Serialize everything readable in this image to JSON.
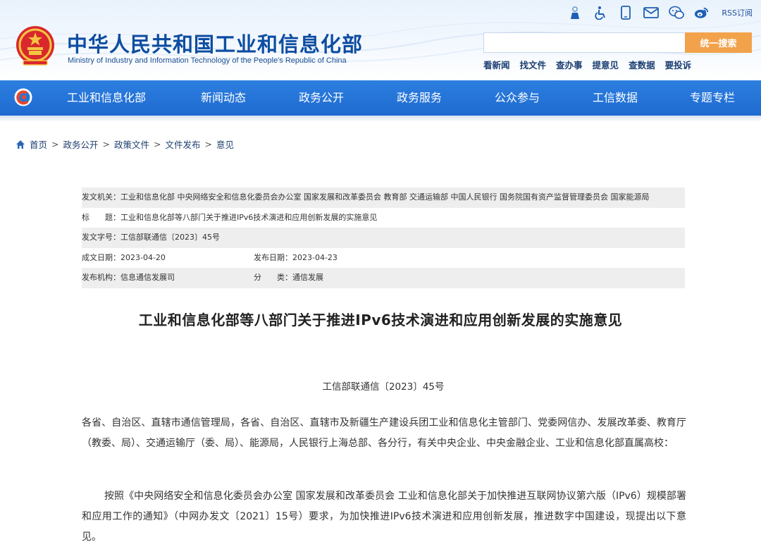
{
  "header": {
    "title": "中华人民共和国工业和信息化部",
    "subtitle": "Ministry of Industry and Information Technology of the People's Republic of China",
    "rss_label": "RSS订阅",
    "icons": [
      "accessibility-care-icon",
      "wheelchair-icon",
      "mobile-icon",
      "mail-icon",
      "wechat-icon",
      "weibo-icon",
      "rss-icon"
    ],
    "search": {
      "placeholder": "",
      "button_label": "统一搜索"
    },
    "quick_links": [
      "看新闻",
      "找文件",
      "查办事",
      "提意见",
      "查数据",
      "要投诉"
    ]
  },
  "nav": {
    "items": [
      "工业和信息化部",
      "新闻动态",
      "政务公开",
      "政务服务",
      "公众参与",
      "工信数据",
      "专题专栏"
    ]
  },
  "breadcrumb": [
    "首页",
    "政务公开",
    "政策文件",
    "文件发布",
    "意见"
  ],
  "meta": {
    "issuer": "发文机关：工业和信息化部 中央网络安全和信息化委员会办公室 国家发展和改革委员会 教育部 交通运输部 中国人民银行 国务院国有资产监督管理委员会 国家能源局",
    "title": "标　　题：工业和信息化部等八部门关于推进IPv6技术演进和应用创新发展的实施意见",
    "doc_number": "发文字号：工信部联通信〔2023〕45号",
    "created": "成文日期：2023-04-20",
    "published": "发布日期：2023-04-23",
    "office": "发布机构：信息通信发展司",
    "category": "分　　类：通信发展"
  },
  "article": {
    "title": "工业和信息化部等八部门关于推进IPv6技术演进和应用创新发展的实施意见",
    "doc_no": "工信部联通信〔2023〕45号",
    "para1": "各省、自治区、直辖市通信管理局，各省、自治区、直辖市及新疆生产建设兵团工业和信息化主管部门、党委网信办、发展改革委、教育厅（教委、局）、交通运输厅（委、局）、能源局，人民银行上海总部、各分行，有关中央企业、中央金融企业、工业和信息化部直属高校：",
    "para2": "按照《中央网络安全和信息化委员会办公室 国家发展和改革委员会 工业和信息化部关于加快推进互联网协议第六版（IPv6）规模部署和应用工作的通知》（中网办发文〔2021〕15号）要求，为加快推进IPv6技术演进和应用创新发展，推进数字中国建设，现提出以下意见。"
  },
  "colors": {
    "brand_blue": "#0d4da1",
    "nav_blue": "#2473d8",
    "search_orange": "#f2a24a"
  }
}
